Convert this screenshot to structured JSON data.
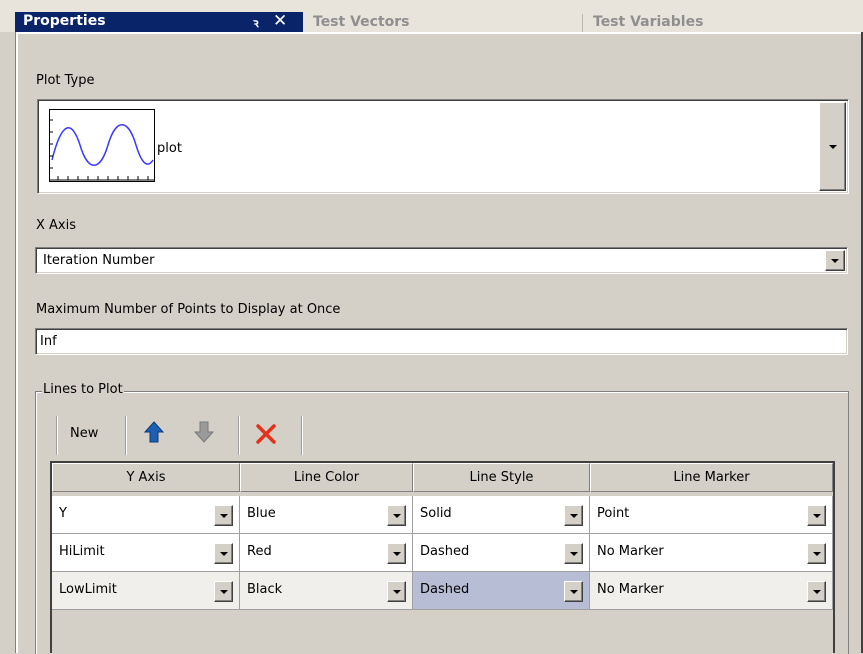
{
  "tabs": {
    "properties": "Properties",
    "pin": "ꝛ",
    "close": "✕",
    "test_vectors": "Test Vectors",
    "test_variables": "Test Variables"
  },
  "plot_type": {
    "label": "Plot Type",
    "selected": "plot"
  },
  "x_axis": {
    "label": "X Axis",
    "selected": "Iteration Number"
  },
  "max_points": {
    "label": "Maximum Number of Points to Display at Once",
    "value": "Inf"
  },
  "lines_group": {
    "title": "Lines to Plot",
    "new_label": "New",
    "icons": {
      "up": "arrow-up-icon",
      "down": "arrow-down-icon",
      "delete": "delete-x-icon"
    },
    "colors": {
      "up": "#1e5fb4",
      "down": "#9a9a9a",
      "delete": "#e2321c"
    }
  },
  "table": {
    "headers": [
      "Y Axis",
      "Line Color",
      "Line Style",
      "Line Marker"
    ],
    "rows": [
      [
        "Y",
        "Blue",
        "Solid",
        "Point"
      ],
      [
        "HiLimit",
        "Red",
        "Dashed",
        "No Marker"
      ],
      [
        "LowLimit",
        "Black",
        "Dashed",
        "No Marker"
      ]
    ]
  },
  "accent": "#0a246a"
}
